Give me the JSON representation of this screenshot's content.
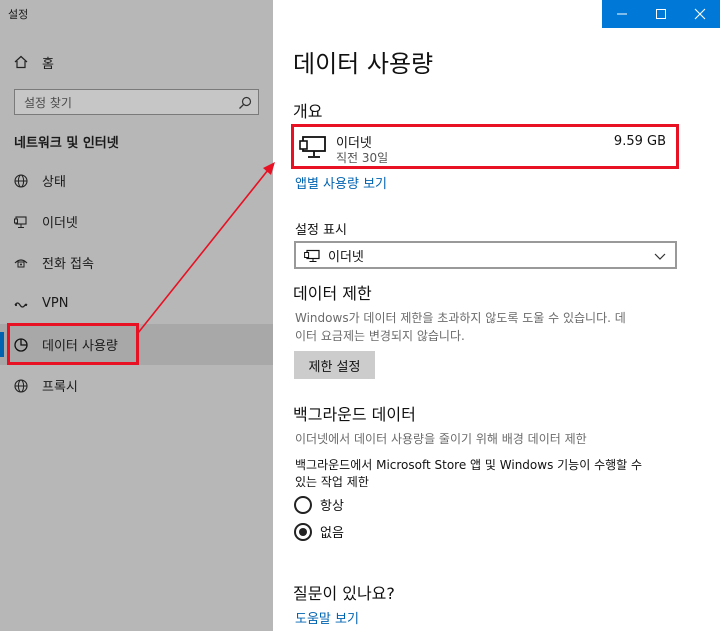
{
  "app_title": "설정",
  "sidebar": {
    "home_label": "홈",
    "search_placeholder": "설정 찾기",
    "section_title": "네트워크 및 인터넷",
    "items": [
      {
        "label": "상태",
        "icon": "globe-icon"
      },
      {
        "label": "이더넷",
        "icon": "ethernet-icon"
      },
      {
        "label": "전화 접속",
        "icon": "dialup-icon"
      },
      {
        "label": "VPN",
        "icon": "vpn-icon"
      },
      {
        "label": "데이터 사용량",
        "icon": "data-usage-icon",
        "selected": true
      },
      {
        "label": "프록시",
        "icon": "proxy-globe-icon"
      }
    ]
  },
  "window_controls": {
    "minimize": "—",
    "maximize": "☐",
    "close": "✕"
  },
  "main": {
    "page_title": "데이터 사용량",
    "overview": {
      "title": "개요",
      "network_name": "이더넷",
      "period": "직전 30일",
      "usage": "9.59 GB",
      "app_usage_link": "앱별 사용량 보기"
    },
    "show_settings": {
      "label": "설정 표시",
      "selected": "이더넷"
    },
    "data_limit": {
      "title": "데이터 제한",
      "desc_line1": "Windows가 데이터 제한을 초과하지 않도록 도울 수 있습니다. 데",
      "desc_line2": "이터 요금제는 변경되지 않습니다.",
      "button": "제한 설정"
    },
    "background_data": {
      "title": "백그라운드 데이터",
      "desc": "이더넷에서 데이터 사용량을 줄이기 위해 배경 데이터 제한",
      "question_line1": "백그라운드에서 Microsoft Store 앱 및 Windows 기능이 수행할 수",
      "question_line2": "있는 작업 제한",
      "options": [
        {
          "label": "항상",
          "checked": false
        },
        {
          "label": "없음",
          "checked": true
        }
      ]
    },
    "questions": {
      "title": "질문이 있나요?",
      "help_link": "도움말 보기"
    }
  },
  "colors": {
    "accent": "#0063b1",
    "highlight": "#e81123",
    "sidebar_bg": "#b7b7b7",
    "titlebar": "#0078d7"
  }
}
